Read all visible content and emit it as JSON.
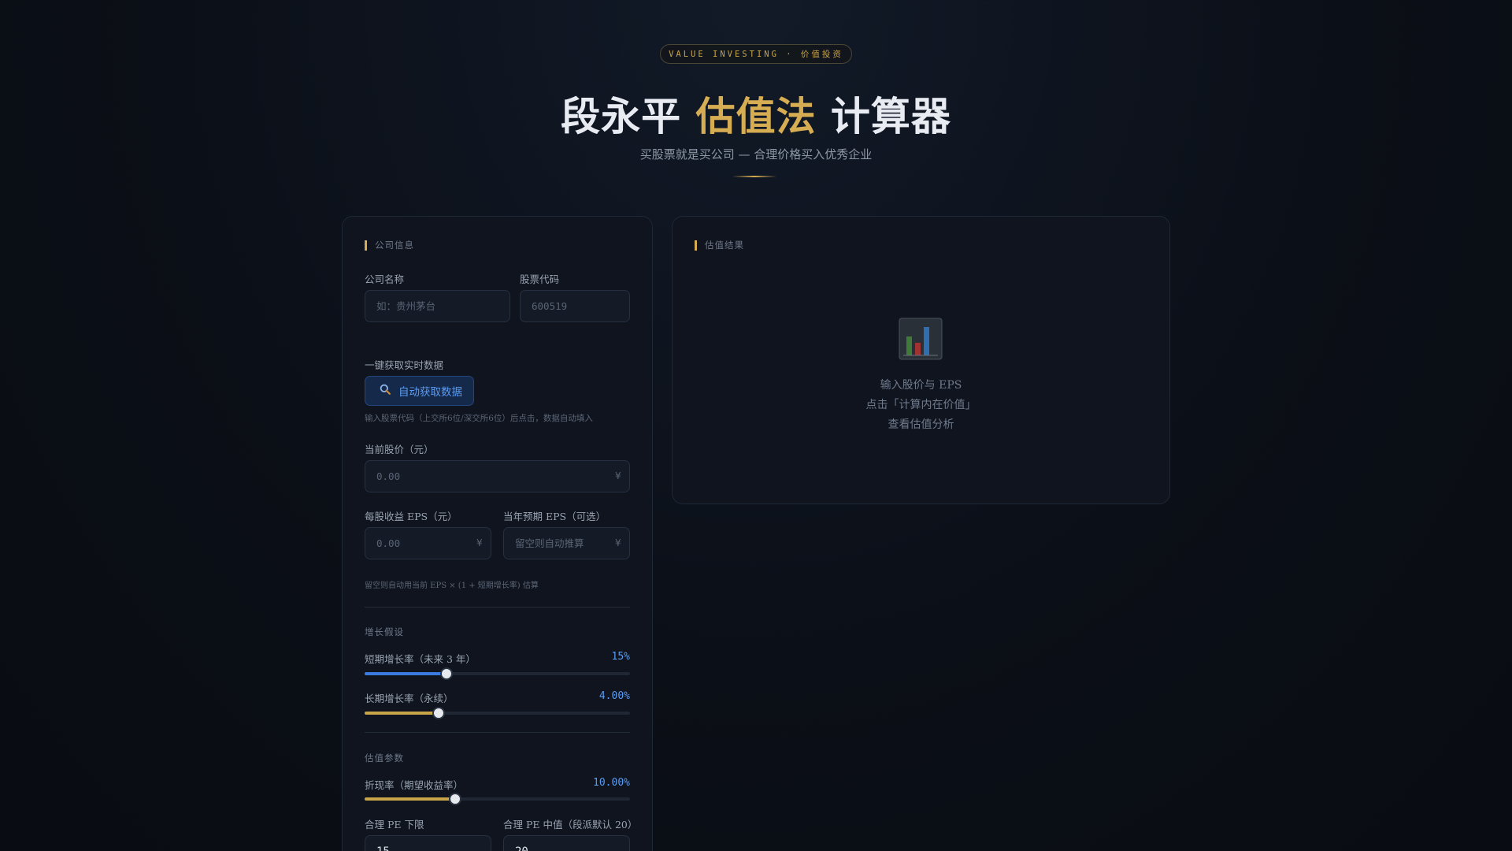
{
  "header": {
    "badge": "VALUE INVESTING · 价值投资",
    "title_part1": "段永平 ",
    "title_highlight": "估值法",
    "title_part2": " 计算器",
    "subtitle": "买股票就是买公司 — 合理价格买入优秀企业"
  },
  "company": {
    "section_title": "公司信息",
    "name_label": "公司名称",
    "name_placeholder": "如：贵州茅台",
    "code_label": "股票代码",
    "code_placeholder": "600519",
    "fetch_label": "一键获取实时数据",
    "fetch_button": "自动获取数据",
    "fetch_icon": "search-icon",
    "fetch_hint": "输入股票代码（上交所6位/深交所6位）后点击，数据自动填入",
    "price_label": "当前股价（元）",
    "price_placeholder": "0.00",
    "currency_symbol": "¥",
    "eps_label": "每股收益 EPS（元）",
    "eps_placeholder": "0.00",
    "forward_eps_label": "当年预期 EPS（可选）",
    "forward_eps_placeholder": "留空则自动推算",
    "eps_hint": "留空则自动用当前 EPS × (1 + 短期增长率) 估算"
  },
  "growth": {
    "section_title": "增长假设",
    "short_label": "短期增长率（未来 3 年）",
    "short_value": "15%",
    "short_fraction": 0.31,
    "long_label": "长期增长率（永续）",
    "long_value": "4.00%",
    "long_fraction": 0.28
  },
  "valuation": {
    "section_title": "估值参数",
    "discount_label": "折现率（期望收益率）",
    "discount_value": "10.00%",
    "discount_fraction": 0.34,
    "pe_low_label": "合理 PE 下限",
    "pe_low_value": "15",
    "pe_mid_label": "合理 PE 中值（段派默认 20）",
    "pe_mid_value": "20"
  },
  "result": {
    "section_title": "估值结果",
    "empty_icon": "bar-chart-icon",
    "line1": "输入股价与 EPS",
    "line2": "点击「计算内在价值」",
    "line3": "查看估值分析"
  },
  "colors": {
    "gold": "#d6ad52",
    "blue": "#3b7be0",
    "slider_gold": "#c9a54a"
  }
}
